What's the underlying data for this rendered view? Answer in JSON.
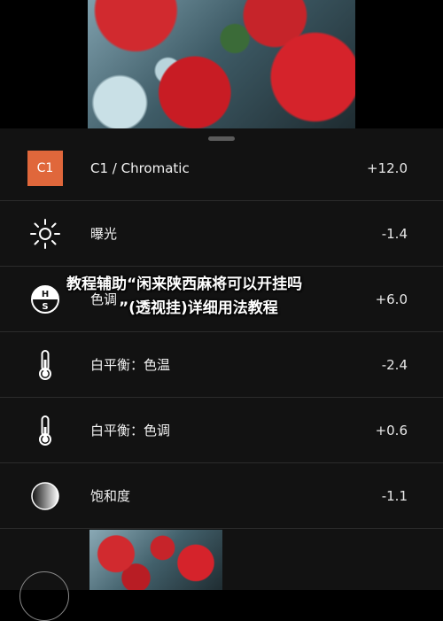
{
  "adjustments": [
    {
      "label": "C1 / Chromatic",
      "value": "+12.0",
      "icon": "c1-badge"
    },
    {
      "label": "曝光",
      "value": "-1.4",
      "icon": "sun-icon"
    },
    {
      "label": "色调",
      "value": "+6.0",
      "icon": "hs-icon"
    },
    {
      "label": "白平衡：色温",
      "value": "-2.4",
      "icon": "thermometer-icon"
    },
    {
      "label": "白平衡：色调",
      "value": "+0.6",
      "icon": "thermometer-icon"
    },
    {
      "label": "饱和度",
      "value": "-1.1",
      "icon": "saturation-icon"
    }
  ],
  "c1_badge_text": "C1",
  "overlay": {
    "line1": "教程辅助“闲来陕西麻将可以开挂吗",
    "line2": "”(透视挂)详细用法教程"
  },
  "colors": {
    "accent": "#e0673b",
    "panel": "#121212"
  }
}
